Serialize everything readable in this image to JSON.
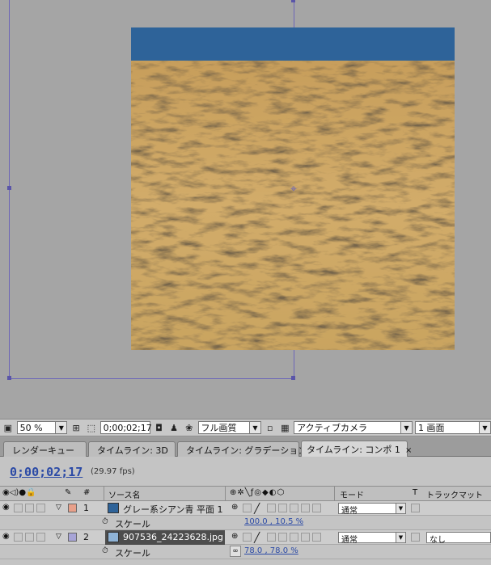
{
  "viewer": {
    "zoom_value": "50 %",
    "timecode_value": "0;00;02;17",
    "resolution_value": "フル画質",
    "camera_value": "アクティブカメラ",
    "view_layout_value": "1 画面"
  },
  "tabs": [
    {
      "label": "レンダーキュー"
    },
    {
      "label": "タイムライン: 3D"
    },
    {
      "label": "タイムライン: グラデーション"
    },
    {
      "label": "タイムライン: コンポ 1",
      "close": "×"
    }
  ],
  "timeline": {
    "timecode": "0;00;02;17",
    "fps": "(29.97 fps)",
    "columns": {
      "number": "#",
      "source_name": "ソース名",
      "mode": "モード",
      "t": "T",
      "track_matte": "トラックマット"
    },
    "layers": [
      {
        "number": "1",
        "name": "グレー系シアン青 平面 1",
        "label_color": "#e8a08a",
        "thumb_color": "#2e6399",
        "mode": "通常",
        "track_matte": "",
        "property": {
          "name": "スケール",
          "value": "100.0 , 10.5 %"
        }
      },
      {
        "number": "2",
        "name": "907536_24223628.jpg",
        "label_color": "#a7a4d6",
        "thumb_color": "#8fb3d6",
        "mode": "通常",
        "track_matte": "なし",
        "property": {
          "name": "スケール",
          "value": "78.0 , 78.0 %"
        }
      }
    ]
  },
  "colors": {
    "solid_layer": "#2e6399",
    "sand": "#c9a25f",
    "timecode_blue": "#2b4aa6",
    "selection_outline": "#6c66b8"
  }
}
